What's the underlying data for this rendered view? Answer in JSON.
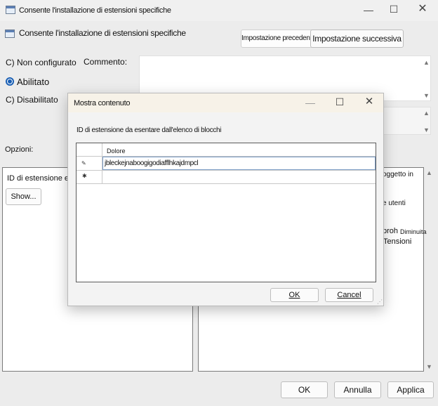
{
  "window": {
    "title": "Consente l'installazione di estensioni specifiche"
  },
  "header": {
    "policy_name": "Consente l'installazione di estensioni specifiche",
    "prev_button": "Impostazione precedente",
    "next_button": "Impostazione successiva"
  },
  "state": {
    "not_configured": "C) Non configurato",
    "enabled": "Abilitato",
    "disabled": "C) Disabilitato",
    "selected": "enabled"
  },
  "comment_label": "Commento:",
  "options_label": "Opzioni:",
  "options_panel": {
    "field_label": "ID di estensione e",
    "show_button": "Show..."
  },
  "help_panel": {
    "fragments": [
      "oggetto in",
      "e utenti",
      "proh",
      "Diminuita",
      "Tensioni"
    ]
  },
  "footer": {
    "ok": "OK",
    "cancel": "Annulla",
    "apply": "Applica"
  },
  "modal": {
    "title": "Mostra contenuto",
    "description": "ID di estensione da esentare dall'elenco di blocchi",
    "column_header": "Dolore",
    "rows": [
      {
        "marker": "✎",
        "value": "jbleckejnaboogigodiafflhkajdmpcl"
      },
      {
        "marker": "✱",
        "value": ""
      }
    ],
    "ok": "OK",
    "cancel": "Cancel"
  }
}
